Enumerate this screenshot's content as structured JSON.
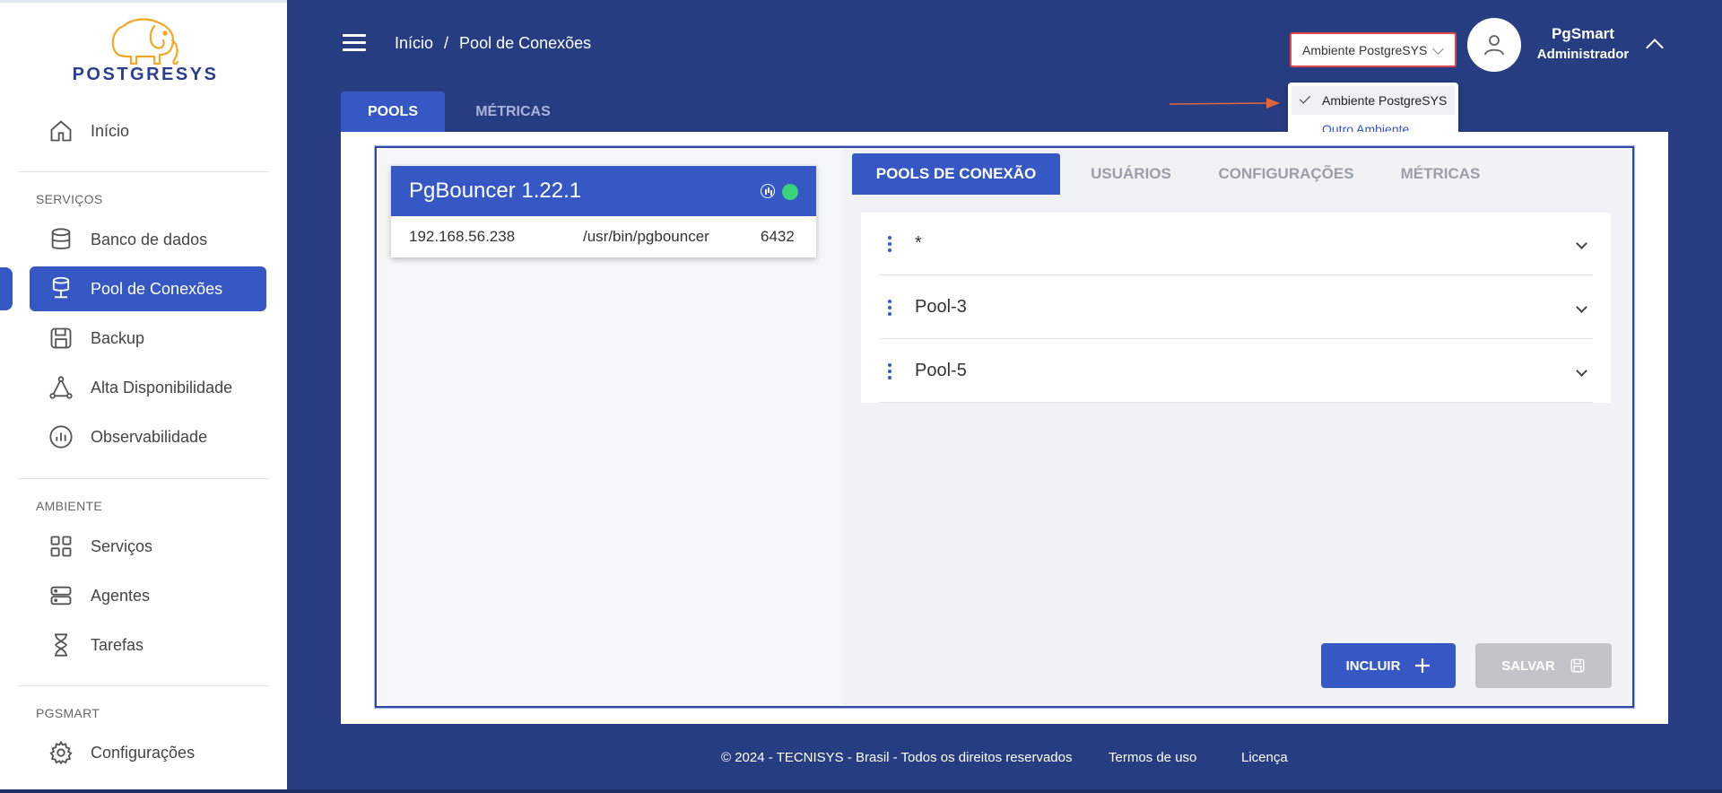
{
  "brand": {
    "logo_text": "POSTGRESYS",
    "logo_color": "#f5a623",
    "text_color": "#2a3f8f"
  },
  "colors": {
    "primary": "#3658c4",
    "navy": "#263d82",
    "status_online": "#3ad27a",
    "highlight_border": "#e04646"
  },
  "sidebar": {
    "home": "Início",
    "sections": [
      {
        "label": "SERVIÇOS",
        "items": [
          "Banco de dados",
          "Pool de Conexões",
          "Backup",
          "Alta Disponibilidade",
          "Observabilidade"
        ]
      },
      {
        "label": "AMBIENTE",
        "items": [
          "Serviços",
          "Agentes",
          "Tarefas"
        ]
      },
      {
        "label": "PGSMART",
        "items": [
          "Configurações"
        ]
      }
    ],
    "active_item": "Pool de Conexões"
  },
  "header": {
    "breadcrumb": [
      "Início",
      "/",
      "Pool de Conexões"
    ],
    "environment_select": "Ambiente PostgreSYS",
    "environment_options": [
      "Ambiente PostgreSYS",
      "Outro Ambiente"
    ],
    "user_name": "PgSmart",
    "user_role": "Administrador"
  },
  "main_tabs": [
    "POOLS",
    "MÉTRICAS"
  ],
  "server_card": {
    "title": "PgBouncer 1.22.1",
    "host": "192.168.56.238",
    "path": "/usr/bin/pgbouncer",
    "port": "6432",
    "status": "online"
  },
  "sub_tabs": [
    "POOLS DE CONEXÃO",
    "USUÁRIOS",
    "CONFIGURAÇÕES",
    "MÉTRICAS"
  ],
  "pools": [
    "*",
    "Pool-3",
    "Pool-5"
  ],
  "buttons": {
    "incluir": "INCLUIR",
    "salvar": "SALVAR"
  },
  "footer": {
    "copyright": "© 2024 - TECNISYS - Brasil - Todos os direitos reservados",
    "terms": "Termos de uso",
    "license": "Licença"
  }
}
